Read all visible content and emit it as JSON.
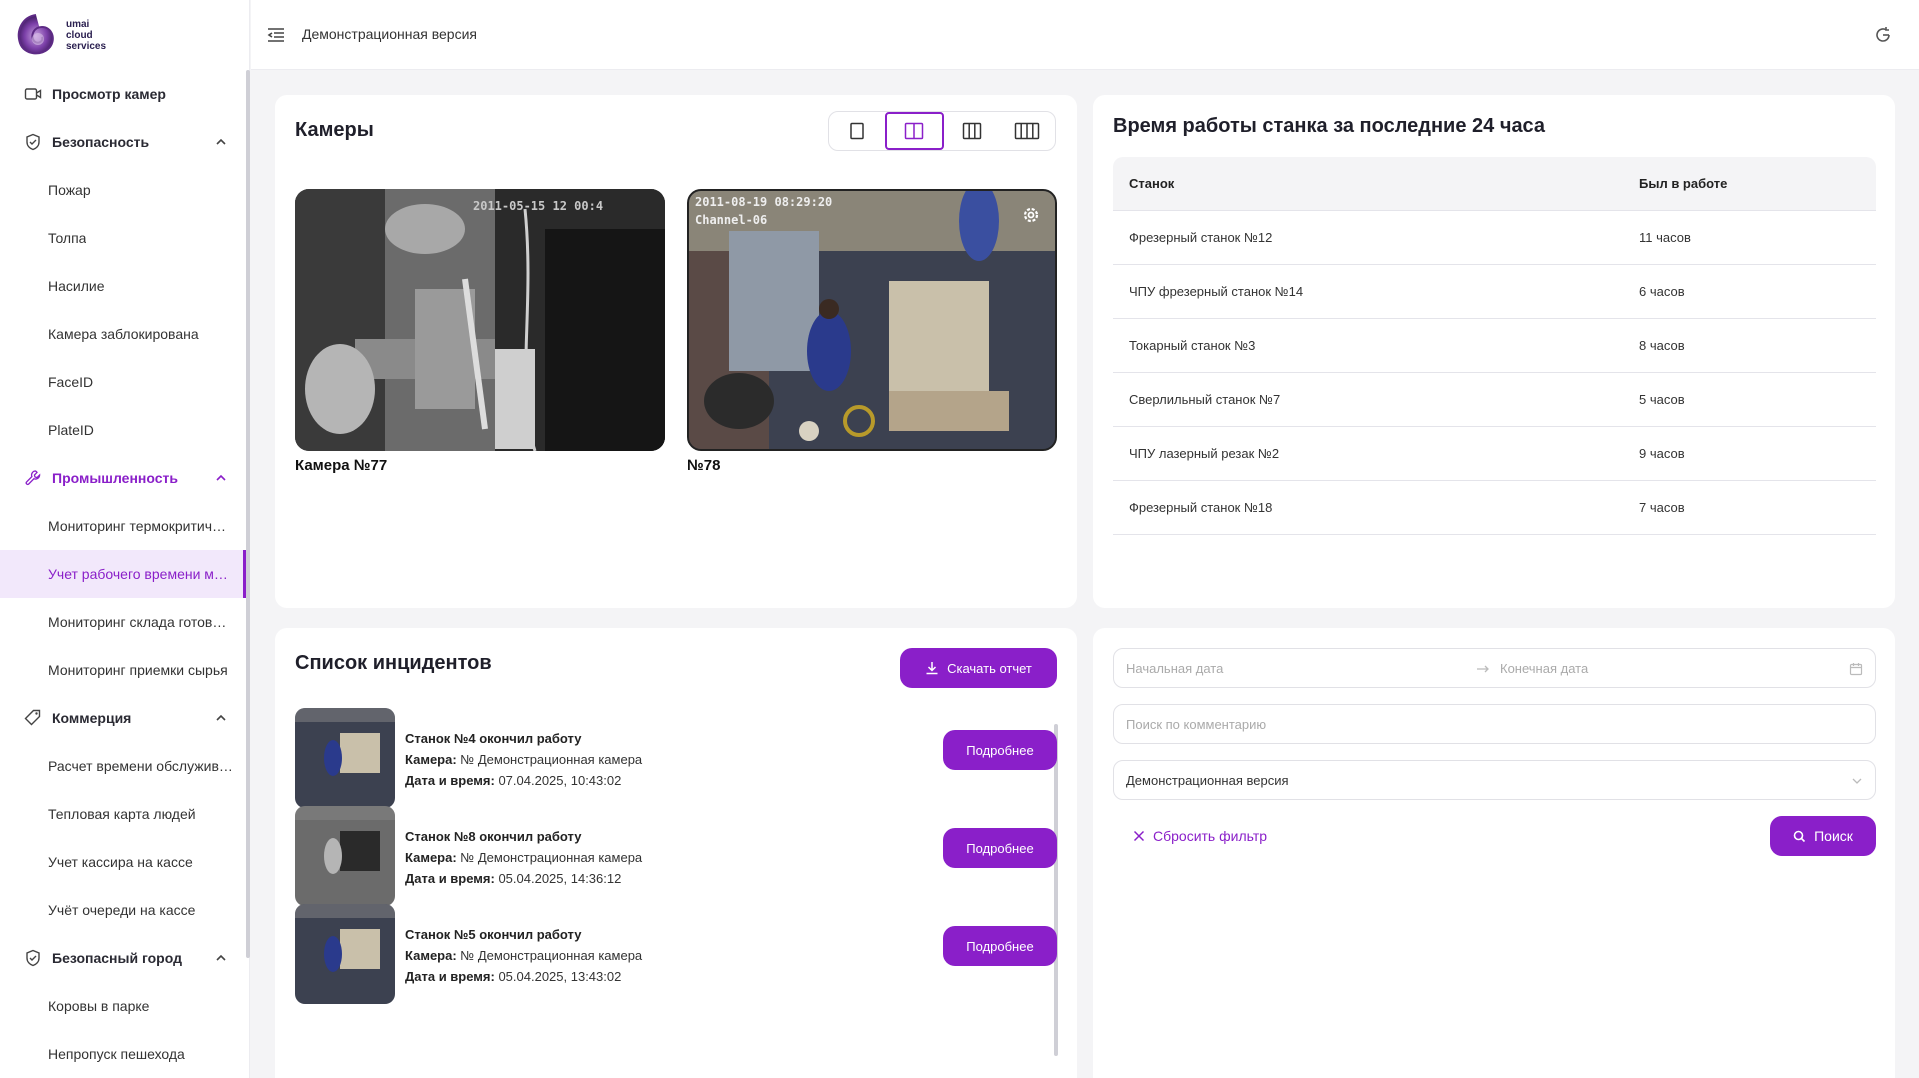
{
  "brand": {
    "line1": "umai",
    "line2": "cloud",
    "line3": "services",
    "color": "#8a1fc9"
  },
  "header": {
    "title": "Демонстрационная версия"
  },
  "sidebar": {
    "items": [
      {
        "label": "Просмотр камер",
        "level": "top",
        "icon": "camera-icon"
      },
      {
        "label": "Безопасность",
        "level": "top",
        "icon": "shield-icon",
        "expanded": true
      },
      {
        "label": "Пожар",
        "level": "sub"
      },
      {
        "label": "Толпа",
        "level": "sub"
      },
      {
        "label": "Насилие",
        "level": "sub"
      },
      {
        "label": "Камера заблокирована",
        "level": "sub"
      },
      {
        "label": "FaceID",
        "level": "sub"
      },
      {
        "label": "PlateID",
        "level": "sub"
      },
      {
        "label": "Промышленность",
        "level": "top",
        "icon": "wrench-icon",
        "expanded": true
      },
      {
        "label": "Мониторинг термокритич…",
        "level": "sub"
      },
      {
        "label": "Учет рабочего времени ма…",
        "level": "sub",
        "active": true
      },
      {
        "label": "Мониторинг склада готов…",
        "level": "sub"
      },
      {
        "label": "Мониторинг приемки сырья",
        "level": "sub"
      },
      {
        "label": "Коммерция",
        "level": "top",
        "icon": "tag-icon",
        "expanded": true
      },
      {
        "label": "Расчет времени обслужив…",
        "level": "sub"
      },
      {
        "label": "Тепловая карта людей",
        "level": "sub"
      },
      {
        "label": "Учет кассира на кассе",
        "level": "sub"
      },
      {
        "label": "Учёт очереди на кассе",
        "level": "sub"
      },
      {
        "label": "Безопасный город",
        "level": "top",
        "icon": "shield-icon",
        "expanded": true
      },
      {
        "label": "Коровы в парке",
        "level": "sub"
      },
      {
        "label": "Непропуск пешехода",
        "level": "sub"
      }
    ]
  },
  "cameras": {
    "title": "Камеры",
    "layout_options": [
      "single-layout-icon",
      "two-column-layout-icon",
      "three-column-layout-icon",
      "four-column-layout-icon"
    ],
    "active_layout": 1,
    "items": [
      {
        "label": "Камера №77",
        "timestamp": "2011-05-15 12 00:4"
      },
      {
        "label": "№78",
        "timestamp": "2011-08-19  08:29:20",
        "channel": "Channel-06"
      }
    ]
  },
  "uptime": {
    "title": "Время работы станка за последние 24 часа",
    "columns": [
      "Станок",
      "Был в работе"
    ],
    "rows": [
      [
        "Фрезерный станок №12",
        "11 часов"
      ],
      [
        "ЧПУ фрезерный станок №14",
        "6 часов"
      ],
      [
        "Токарный станок №3",
        "8 часов"
      ],
      [
        "Сверлильный станок №7",
        "5 часов"
      ],
      [
        "ЧПУ лазерный резак №2",
        "9 часов"
      ],
      [
        "Фрезерный станок №18",
        "7 часов"
      ]
    ]
  },
  "incidents": {
    "title": "Список инцидентов",
    "download_label": "Скачать отчет",
    "more_label": "Подробнее",
    "camera_key": "Камера:",
    "datetime_key": "Дата и время:",
    "items": [
      {
        "title": "Станок №4 окончил работу",
        "camera": "№ Демонстрационная камера",
        "datetime": "07.04.2025, 10:43:02"
      },
      {
        "title": "Станок №8 окончил работу",
        "camera": "№ Демонстрационная камера",
        "datetime": "05.04.2025, 14:36:12"
      },
      {
        "title": "Станок №5 окончил работу",
        "camera": "№ Демонстрационная камера",
        "datetime": "05.04.2025, 13:43:02"
      }
    ]
  },
  "filters": {
    "start_date_placeholder": "Начальная дата",
    "end_date_placeholder": "Конечная дата",
    "comment_placeholder": "Поиск по комментарию",
    "org_value": "Демонстрационная версия",
    "reset_label": "Сбросить фильтр",
    "search_label": "Поиск"
  }
}
